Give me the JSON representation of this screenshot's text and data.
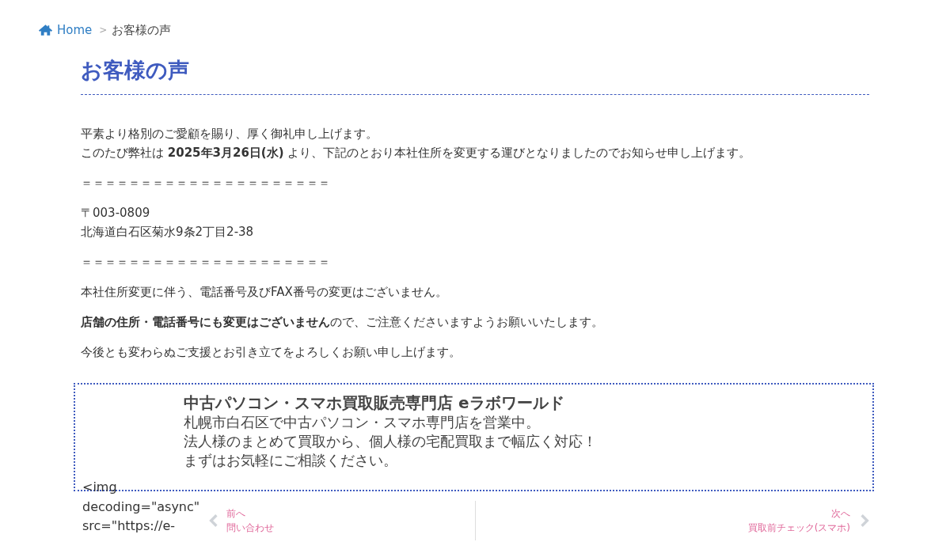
{
  "breadcrumb": {
    "home": "Home",
    "separator": ">",
    "current": "お客様の声"
  },
  "title": "お客様の声",
  "paragraphs": [
    {
      "lines": [
        "平素より格別のご愛顧を賜り、厚く御礼申し上げます。",
        "このたび弊社は **2025年3月26日(水)** より、下記のとおり本社住所を変更する運びとなりましたのでお知らせ申し上げます。"
      ]
    },
    {
      "lines": [
        "＝＝＝＝＝＝＝＝＝＝＝＝＝＝＝＝＝＝＝＝＝"
      ]
    },
    {
      "lines": [
        "〒003-0809",
        "北海道白石区菊水9条2丁目2-38"
      ]
    },
    {
      "lines": [
        "＝＝＝＝＝＝＝＝＝＝＝＝＝＝＝＝＝＝＝＝＝"
      ]
    },
    {
      "lines": [
        "本社住所変更に伴う、電話番号及びFAX番号の変更はございません。"
      ]
    },
    {
      "lines": [
        "**店舗の住所・電話番号にも変更はございません**ので、ご注意くださいますようお願いいたします。"
      ]
    },
    {
      "lines": [
        "今後とも変わらぬご支援とお引き立てをよろしくお願い申し上げます。"
      ]
    }
  ],
  "shop_box": {
    "name": "中古パソコン・スマホ買取販売専門店 eラボワールド",
    "lines": [
      "札幌市白石区で中古パソコン・スマホ専門店を営業中。",
      "法人様のまとめて買取から、個人様の宅配買取まで幅広く対応！",
      "まずはお気軽にご相談ください。"
    ],
    "code_lines": [
      "<img",
      "decoding=\"async\"",
      "src=\"https://e-"
    ]
  },
  "post_nav": {
    "prev": {
      "label": "前へ",
      "title": "問い合わせ"
    },
    "next": {
      "label": "次へ",
      "title": "買取前チェック(スマホ)"
    }
  }
}
